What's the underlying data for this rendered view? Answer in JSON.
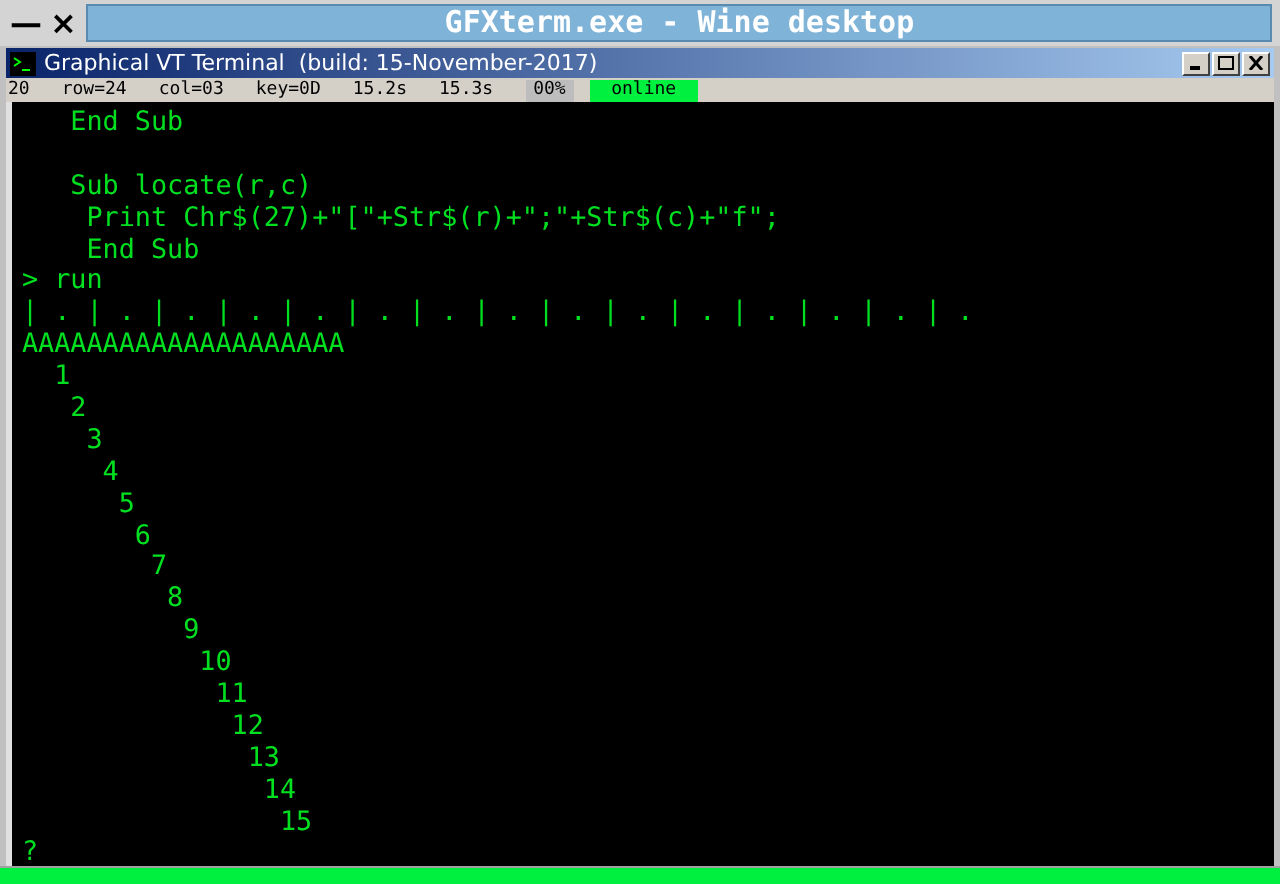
{
  "desktop": {
    "title": "GFXterm.exe - Wine desktop",
    "controls": [
      "—",
      "×"
    ]
  },
  "window": {
    "title": "Graphical VT Terminal  (build: 15-November-2017)"
  },
  "status_bar": [
    {
      "kind": "text",
      "text": "20"
    },
    {
      "kind": "text",
      "text": "row=24"
    },
    {
      "kind": "text",
      "text": "col=03"
    },
    {
      "kind": "text",
      "text": "key=0D"
    },
    {
      "kind": "text",
      "text": "15.2s"
    },
    {
      "kind": "text",
      "text": "15.3s"
    },
    {
      "kind": "box",
      "text": "00%"
    },
    {
      "kind": "online",
      "text": "online"
    }
  ],
  "terminal_blocks": [
    [
      "   End Sub"
    ],
    [
      "   Sub locate(r,c)",
      "    Print Chr$(27)+\"[\"+Str$(r)+\";\"+Str$(c)+\"f\";",
      "    End Sub",
      "> run",
      "| . | . | . | . | . | . | . | . | . | . | . | . | . | . | .",
      "AAAAAAAAAAAAAAAAAAAA",
      "  1",
      "   2",
      "    3",
      "     4",
      "      5",
      "       6",
      "        7",
      "         8",
      "          9",
      "           10",
      "            11",
      "             12",
      "              13",
      "               14",
      "                15",
      "?"
    ]
  ]
}
